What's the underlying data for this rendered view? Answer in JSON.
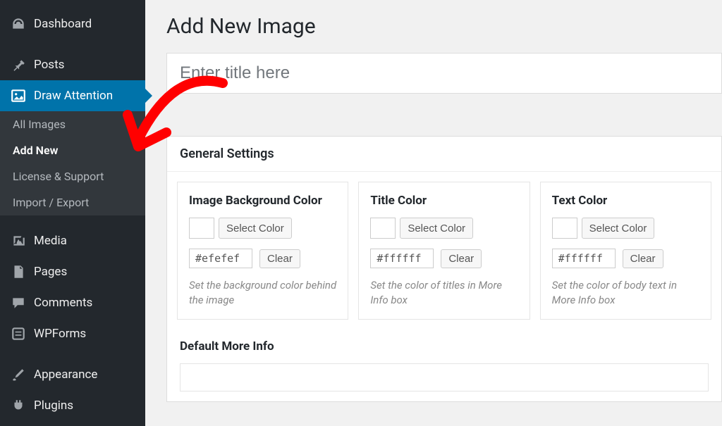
{
  "sidebar": {
    "items": [
      {
        "label": "Dashboard",
        "icon": "dashboard"
      },
      {
        "label": "Posts",
        "icon": "pin"
      },
      {
        "label": "Draw Attention",
        "icon": "image"
      },
      {
        "label": "Media",
        "icon": "media"
      },
      {
        "label": "Pages",
        "icon": "page"
      },
      {
        "label": "Comments",
        "icon": "comment"
      },
      {
        "label": "WPForms",
        "icon": "form"
      },
      {
        "label": "Appearance",
        "icon": "brush"
      },
      {
        "label": "Plugins",
        "icon": "plugin"
      }
    ],
    "sub_items": [
      {
        "label": "All Images"
      },
      {
        "label": "Add New"
      },
      {
        "label": "License & Support"
      },
      {
        "label": "Import / Export"
      }
    ]
  },
  "page": {
    "title": "Add New Image",
    "title_placeholder": "Enter title here"
  },
  "settings": {
    "header": "General Settings",
    "select_color_label": "Select Color",
    "clear_label": "Clear",
    "colors": [
      {
        "title": "Image Background Color",
        "hex": "#efefef",
        "desc": "Set the background color behind the image"
      },
      {
        "title": "Title Color",
        "hex": "#ffffff",
        "desc": "Set the color of titles in More Info box"
      },
      {
        "title": "Text Color",
        "hex": "#ffffff",
        "desc": "Set the color of body text in More Info box"
      }
    ],
    "more_info_title": "Default More Info"
  }
}
